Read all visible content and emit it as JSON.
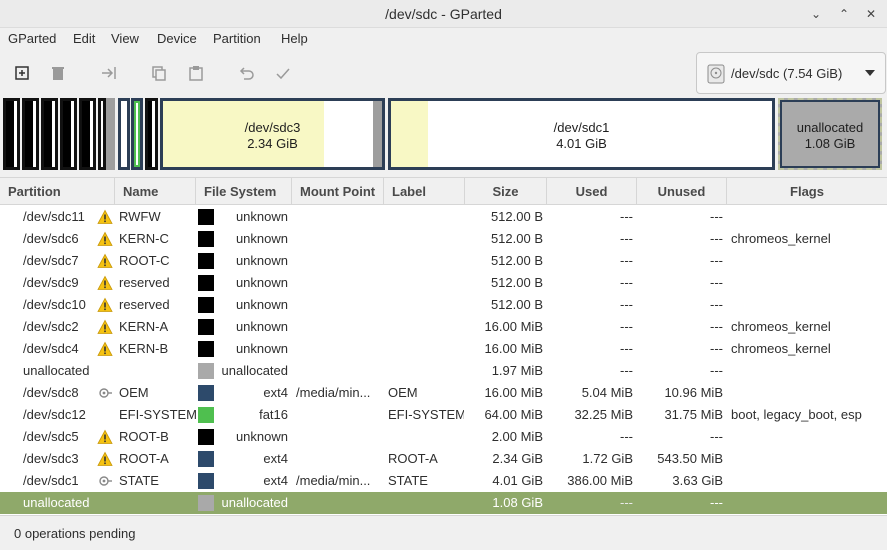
{
  "window": {
    "title": "/dev/sdc - GParted",
    "min": "⌄",
    "max": "⌃",
    "close": "✕"
  },
  "menu": [
    "GParted",
    "Edit",
    "View",
    "Device",
    "Partition",
    "Help"
  ],
  "toolbar": [
    "new-icon",
    "delete-icon",
    "resize-move-icon",
    "copy-icon",
    "paste-icon",
    "undo-icon",
    "apply-icon"
  ],
  "device": {
    "label": "/dev/sdc  (7.54 GiB)"
  },
  "diskmap": {
    "sdc3": {
      "name": "/dev/sdc3",
      "size": "2.34 GiB"
    },
    "sdc1": {
      "name": "/dev/sdc1",
      "size": "4.01 GiB"
    },
    "unallocated": {
      "name": "unallocated",
      "size": "1.08 GiB"
    }
  },
  "table": {
    "headers": [
      "Partition",
      "Name",
      "File System",
      "Mount Point",
      "Label",
      "Size",
      "Used",
      "Unused",
      "Flags"
    ],
    "rows": [
      {
        "partition": "/dev/sdc11",
        "icon": "warning",
        "name": "RWFW",
        "fs_color": "#000000",
        "fs": "unknown",
        "mount": "",
        "label": "",
        "size": "512.00 B",
        "used": "---",
        "unused": "---",
        "flags": ""
      },
      {
        "partition": "/dev/sdc6",
        "icon": "warning",
        "name": "KERN-C",
        "fs_color": "#000000",
        "fs": "unknown",
        "mount": "",
        "label": "",
        "size": "512.00 B",
        "used": "---",
        "unused": "---",
        "flags": "chromeos_kernel"
      },
      {
        "partition": "/dev/sdc7",
        "icon": "warning",
        "name": "ROOT-C",
        "fs_color": "#000000",
        "fs": "unknown",
        "mount": "",
        "label": "",
        "size": "512.00 B",
        "used": "---",
        "unused": "---",
        "flags": ""
      },
      {
        "partition": "/dev/sdc9",
        "icon": "warning",
        "name": "reserved",
        "fs_color": "#000000",
        "fs": "unknown",
        "mount": "",
        "label": "",
        "size": "512.00 B",
        "used": "---",
        "unused": "---",
        "flags": ""
      },
      {
        "partition": "/dev/sdc10",
        "icon": "warning",
        "name": "reserved",
        "fs_color": "#000000",
        "fs": "unknown",
        "mount": "",
        "label": "",
        "size": "512.00 B",
        "used": "---",
        "unused": "---",
        "flags": ""
      },
      {
        "partition": "/dev/sdc2",
        "icon": "warning",
        "name": "KERN-A",
        "fs_color": "#000000",
        "fs": "unknown",
        "mount": "",
        "label": "",
        "size": "16.00 MiB",
        "used": "---",
        "unused": "---",
        "flags": "chromeos_kernel"
      },
      {
        "partition": "/dev/sdc4",
        "icon": "warning",
        "name": "KERN-B",
        "fs_color": "#000000",
        "fs": "unknown",
        "mount": "",
        "label": "",
        "size": "16.00 MiB",
        "used": "---",
        "unused": "---",
        "flags": "chromeos_kernel"
      },
      {
        "partition": "unallocated",
        "icon": "",
        "name": "",
        "fs_color": "#a9a9a9",
        "fs": "unallocated",
        "mount": "",
        "label": "",
        "size": "1.97 MiB",
        "used": "---",
        "unused": "---",
        "flags": ""
      },
      {
        "partition": "/dev/sdc8",
        "icon": "mounted",
        "name": "OEM",
        "fs_color": "#2d4a6b",
        "fs": "ext4",
        "mount": "/media/min...",
        "label": "OEM",
        "size": "16.00 MiB",
        "used": "5.04 MiB",
        "unused": "10.96 MiB",
        "flags": ""
      },
      {
        "partition": "/dev/sdc12",
        "icon": "",
        "name": "EFI-SYSTEM",
        "fs_color": "#4fbf4f",
        "fs": "fat16",
        "mount": "",
        "label": "EFI-SYSTEM",
        "size": "64.00 MiB",
        "used": "32.25 MiB",
        "unused": "31.75 MiB",
        "flags": "boot, legacy_boot, esp"
      },
      {
        "partition": "/dev/sdc5",
        "icon": "warning",
        "name": "ROOT-B",
        "fs_color": "#000000",
        "fs": "unknown",
        "mount": "",
        "label": "",
        "size": "2.00 MiB",
        "used": "---",
        "unused": "---",
        "flags": ""
      },
      {
        "partition": "/dev/sdc3",
        "icon": "warning",
        "name": "ROOT-A",
        "fs_color": "#2d4a6b",
        "fs": "ext4",
        "mount": "",
        "label": "ROOT-A",
        "size": "2.34 GiB",
        "used": "1.72 GiB",
        "unused": "543.50 MiB",
        "flags": ""
      },
      {
        "partition": "/dev/sdc1",
        "icon": "mounted",
        "name": "STATE",
        "fs_color": "#2d4a6b",
        "fs": "ext4",
        "mount": "/media/min...",
        "label": "STATE",
        "size": "4.01 GiB",
        "used": "386.00 MiB",
        "unused": "3.63 GiB",
        "flags": ""
      },
      {
        "partition": "unallocated",
        "icon": "",
        "name": "",
        "fs_color": "#a9a9a9",
        "fs": "unallocated",
        "mount": "",
        "label": "",
        "size": "1.08 GiB",
        "used": "---",
        "unused": "---",
        "flags": "",
        "selected": true
      }
    ]
  },
  "status": {
    "text": "0 operations pending"
  }
}
